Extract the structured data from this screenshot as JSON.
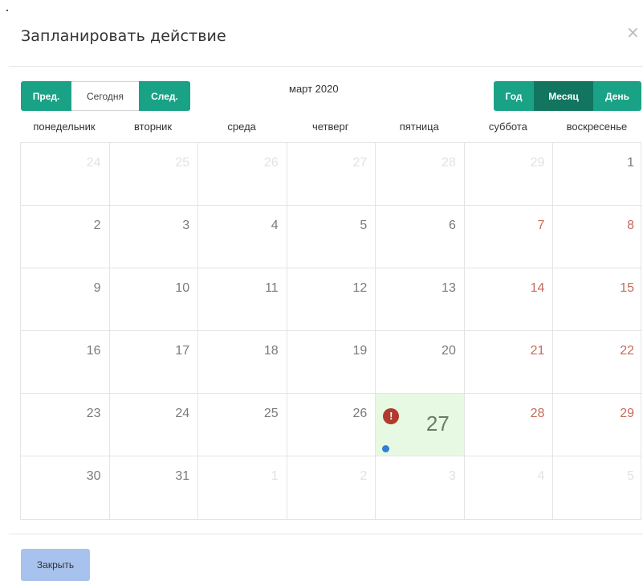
{
  "modal": {
    "title": "Запланировать действие",
    "close_icon": "×"
  },
  "toolbar": {
    "prev_label": "Пред.",
    "today_label": "Сегодня",
    "next_label": "След.",
    "month_title": "март 2020",
    "view_year": "Год",
    "view_month": "Месяц",
    "view_day": "День",
    "active_view": "Месяц"
  },
  "weekdays": [
    "понедельник",
    "вторник",
    "среда",
    "четверг",
    "пятница",
    "суббота",
    "воскресенье"
  ],
  "weeks": [
    [
      {
        "n": "24",
        "other": true
      },
      {
        "n": "25",
        "other": true
      },
      {
        "n": "26",
        "other": true
      },
      {
        "n": "27",
        "other": true
      },
      {
        "n": "28",
        "other": true
      },
      {
        "n": "29",
        "other": true
      },
      {
        "n": "1",
        "weekend": false
      }
    ],
    [
      {
        "n": "2"
      },
      {
        "n": "3"
      },
      {
        "n": "4"
      },
      {
        "n": "5"
      },
      {
        "n": "6"
      },
      {
        "n": "7",
        "weekend": true
      },
      {
        "n": "8",
        "weekend": true
      }
    ],
    [
      {
        "n": "9"
      },
      {
        "n": "10"
      },
      {
        "n": "11"
      },
      {
        "n": "12"
      },
      {
        "n": "13"
      },
      {
        "n": "14",
        "weekend": true
      },
      {
        "n": "15",
        "weekend": true
      }
    ],
    [
      {
        "n": "16"
      },
      {
        "n": "17"
      },
      {
        "n": "18"
      },
      {
        "n": "19"
      },
      {
        "n": "20"
      },
      {
        "n": "21",
        "weekend": true
      },
      {
        "n": "22",
        "weekend": true
      }
    ],
    [
      {
        "n": "23"
      },
      {
        "n": "24"
      },
      {
        "n": "25"
      },
      {
        "n": "26"
      },
      {
        "n": "27",
        "today": true,
        "event": true
      },
      {
        "n": "28",
        "weekend": true
      },
      {
        "n": "29",
        "weekend": true
      }
    ],
    [
      {
        "n": "30"
      },
      {
        "n": "31"
      },
      {
        "n": "1",
        "other": true
      },
      {
        "n": "2",
        "other": true
      },
      {
        "n": "3",
        "other": true
      },
      {
        "n": "4",
        "other": true
      },
      {
        "n": "5",
        "other": true
      }
    ]
  ],
  "event_marker": "!",
  "footer": {
    "close_label": "Закрыть"
  },
  "colors": {
    "primary_green": "#1aa286",
    "active_green": "#127560",
    "today_bg": "#e7f9e2",
    "weekend_text": "#c46b5b",
    "event_red": "#b13a2f",
    "event_dot": "#2f7fd4",
    "close_button": "#a7c2ec"
  }
}
